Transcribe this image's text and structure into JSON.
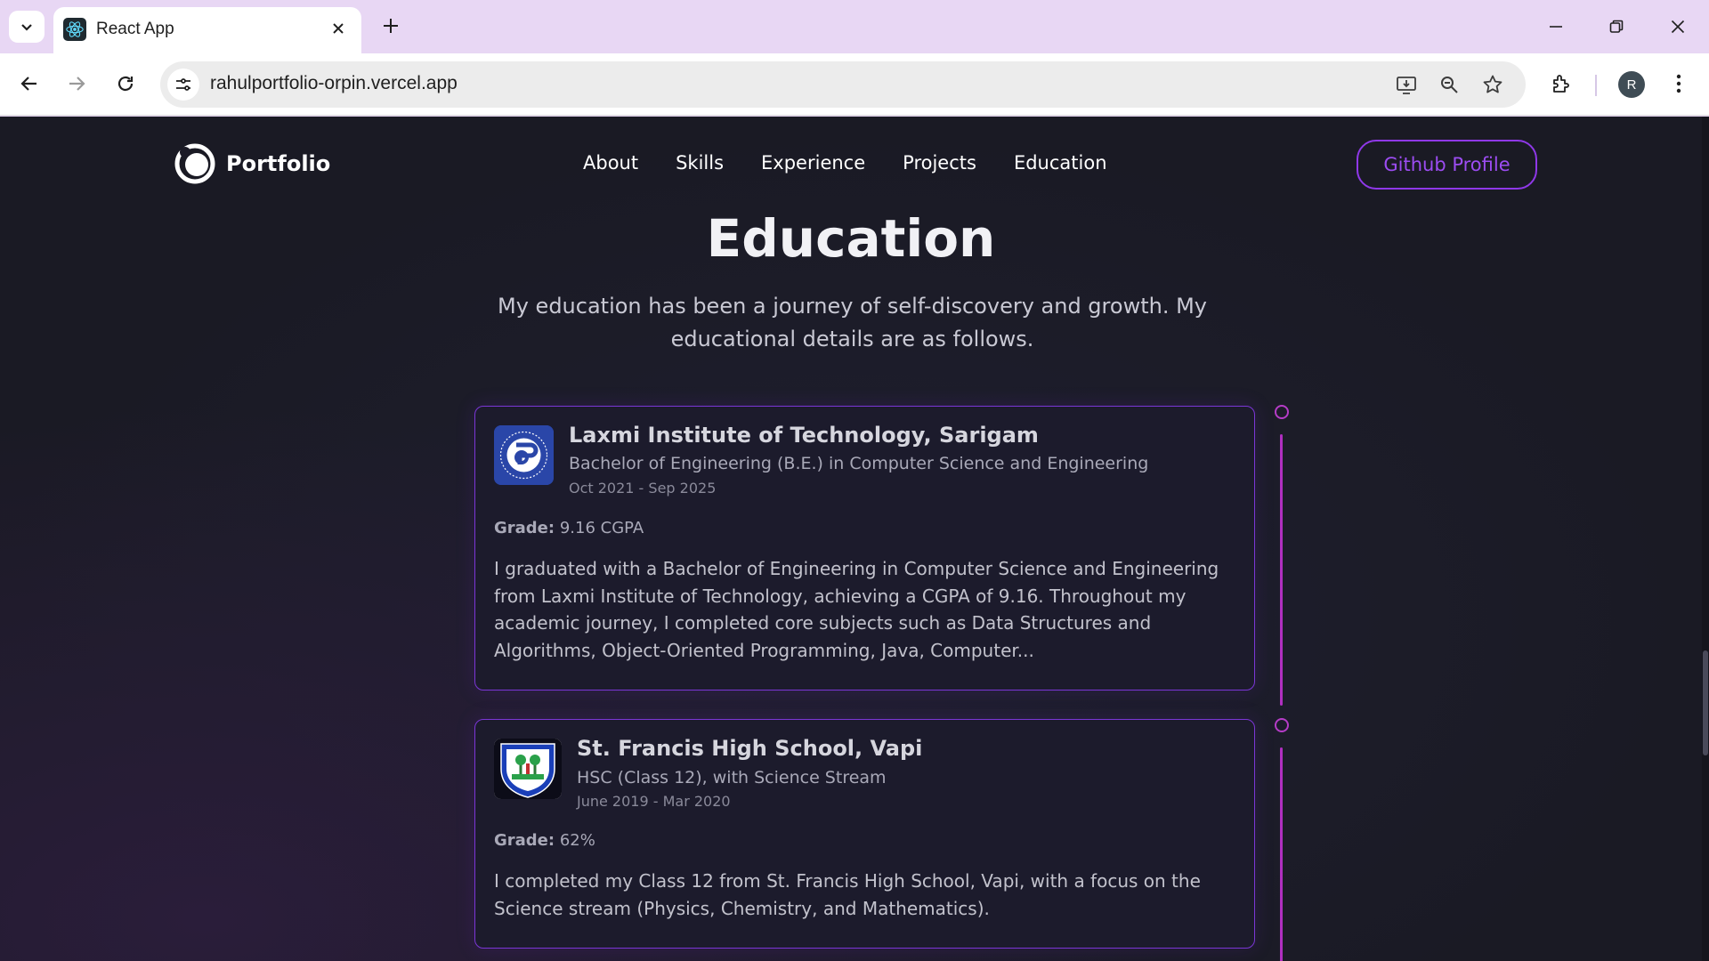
{
  "browser": {
    "tab_title": "React App",
    "url": "rahulportfolio-orpin.vercel.app",
    "profile_initial": "R"
  },
  "site": {
    "logo_text": "Portfolio",
    "nav": [
      "About",
      "Skills",
      "Experience",
      "Projects",
      "Education"
    ],
    "github_button": "Github Profile",
    "accent_color": "#8f38e8",
    "timeline_color": "#b02fc0"
  },
  "education": {
    "title": "Education",
    "description": "My education has been a journey of self-discovery and growth. My educational details are as follows.",
    "items": [
      {
        "school": "Laxmi Institute of Technology, Sarigam",
        "degree": "Bachelor of Engineering (B.E.) in Computer Science and Engineering",
        "date": "Oct 2021 - Sep 2025",
        "grade_label": "Grade:",
        "grade": "9.16 CGPA",
        "description": "I graduated with a Bachelor of Engineering in Computer Science and Engineering from Laxmi Institute of Technology, achieving a CGPA of 9.16. Throughout my academic journey, I completed core subjects such as Data Structures and Algorithms, Object-Oriented Programming, Java, Computer..."
      },
      {
        "school": "St. Francis High School, Vapi",
        "degree": "HSC (Class 12), with Science Stream",
        "date": "June 2019 - Mar 2020",
        "grade_label": "Grade:",
        "grade": "62%",
        "description": "I completed my Class 12 from St. Francis High School, Vapi, with a focus on the Science stream (Physics, Chemistry, and Mathematics)."
      }
    ]
  }
}
